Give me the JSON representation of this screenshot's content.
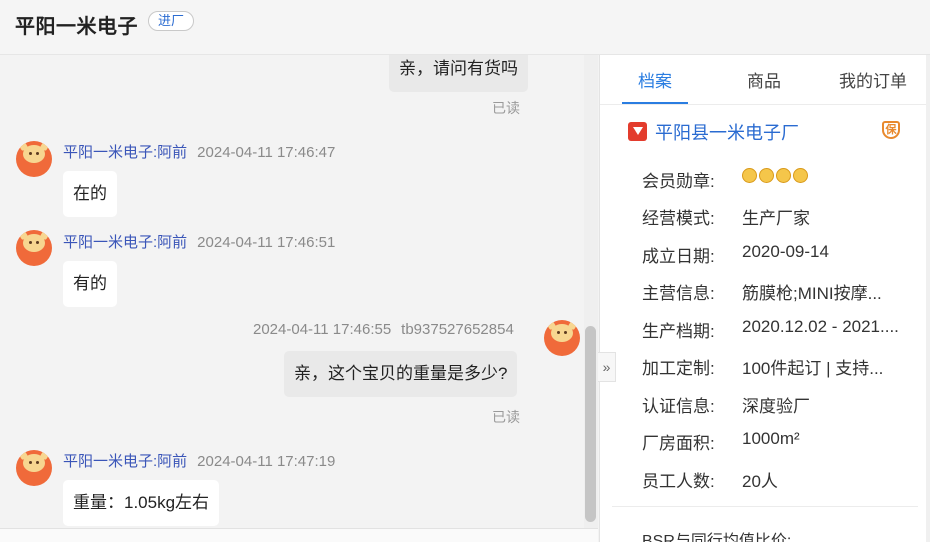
{
  "header": {
    "shop_title": "平阳一米电子",
    "badge": "进厂"
  },
  "chat": {
    "m1": {
      "text": "亲，请问有货吗",
      "read": "已读"
    },
    "m2": {
      "sender": "平阳一米电子:阿前",
      "time": "2024-04-11 17:46:47",
      "text": "在的"
    },
    "m3": {
      "sender": "平阳一米电子:阿前",
      "time": "2024-04-11 17:46:51",
      "text": "有的"
    },
    "m4": {
      "time": "2024-04-11 17:46:55",
      "sender": "tb937527652854",
      "text": "亲，这个宝贝的重量是多少?",
      "read": "已读"
    },
    "m5": {
      "sender": "平阳一米电子:阿前",
      "time": "2024-04-11 17:47:19",
      "text": "重量：1.05kg左右"
    }
  },
  "collapse_icon": "double-chevron-right-icon",
  "panel": {
    "tabs": [
      "档案",
      "商品",
      "我的订单"
    ],
    "active_tab": "档案",
    "company_name": "平阳县一米电子厂",
    "rows": [
      {
        "label": "会员勋章:",
        "value": ""
      },
      {
        "label": "经营模式:",
        "value": "生产厂家"
      },
      {
        "label": "成立日期:",
        "value": "2020-09-14"
      },
      {
        "label": "主营信息:",
        "value": "筋膜枪;MINI按摩..."
      },
      {
        "label": "生产档期:",
        "value": "2020.12.02 - 2021...."
      },
      {
        "label": "加工定制:",
        "value": "100件起订 | 支持..."
      },
      {
        "label": "认证信息:",
        "value": "深度验厂"
      },
      {
        "label": "厂房面积:",
        "value": "1000m²"
      },
      {
        "label": "员工人数:",
        "value": "20人"
      }
    ],
    "medal_count": 4,
    "bsr_label": "BSR与同行均值比价:"
  },
  "colors": {
    "accent": "#2a7de1",
    "brand_red": "#e33c2d",
    "avatar_orange": "#f06a3a"
  }
}
